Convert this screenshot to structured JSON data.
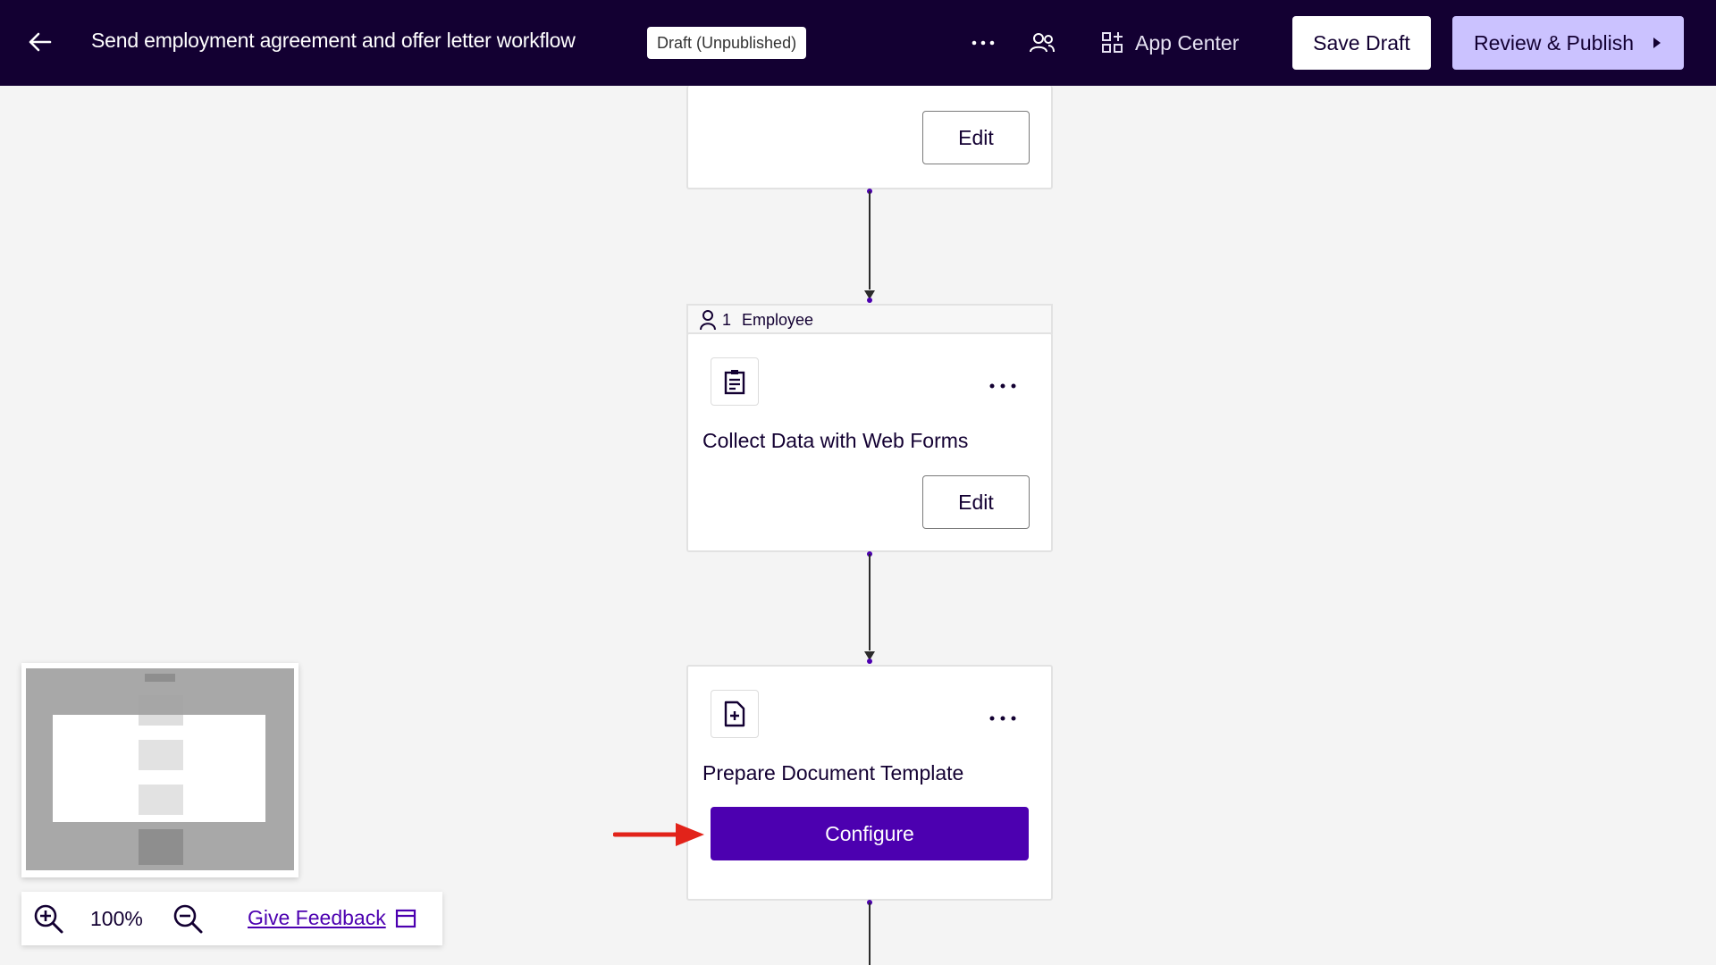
{
  "header": {
    "title": "Send employment agreement and offer letter workflow",
    "status_badge": "Draft (Unpublished)",
    "app_center_label": "App Center",
    "save_draft_label": "Save Draft",
    "review_publish_label": "Review & Publish"
  },
  "workflow": {
    "steps": [
      {
        "title": "",
        "button_label": "Edit"
      },
      {
        "role_count": "1",
        "role_label": "Employee",
        "title": "Collect Data with Web Forms",
        "button_label": "Edit"
      },
      {
        "title": "Prepare Document Template",
        "button_label": "Configure"
      }
    ]
  },
  "zoom": {
    "level": "100%",
    "feedback_label": "Give Feedback"
  },
  "colors": {
    "header_bg": "#130032",
    "primary": "#4c00b0",
    "review_button_bg": "#cbc2ff",
    "canvas_bg": "#f4f4f4",
    "annotation_arrow": "#e2231a"
  },
  "icons": [
    "arrow-left-icon",
    "more-horizontal-icon",
    "users-icon",
    "app-center-grid-icon",
    "caret-right-icon",
    "clipboard-form-icon",
    "document-add-icon",
    "user-icon",
    "zoom-in-icon",
    "zoom-out-icon",
    "panel-icon"
  ]
}
